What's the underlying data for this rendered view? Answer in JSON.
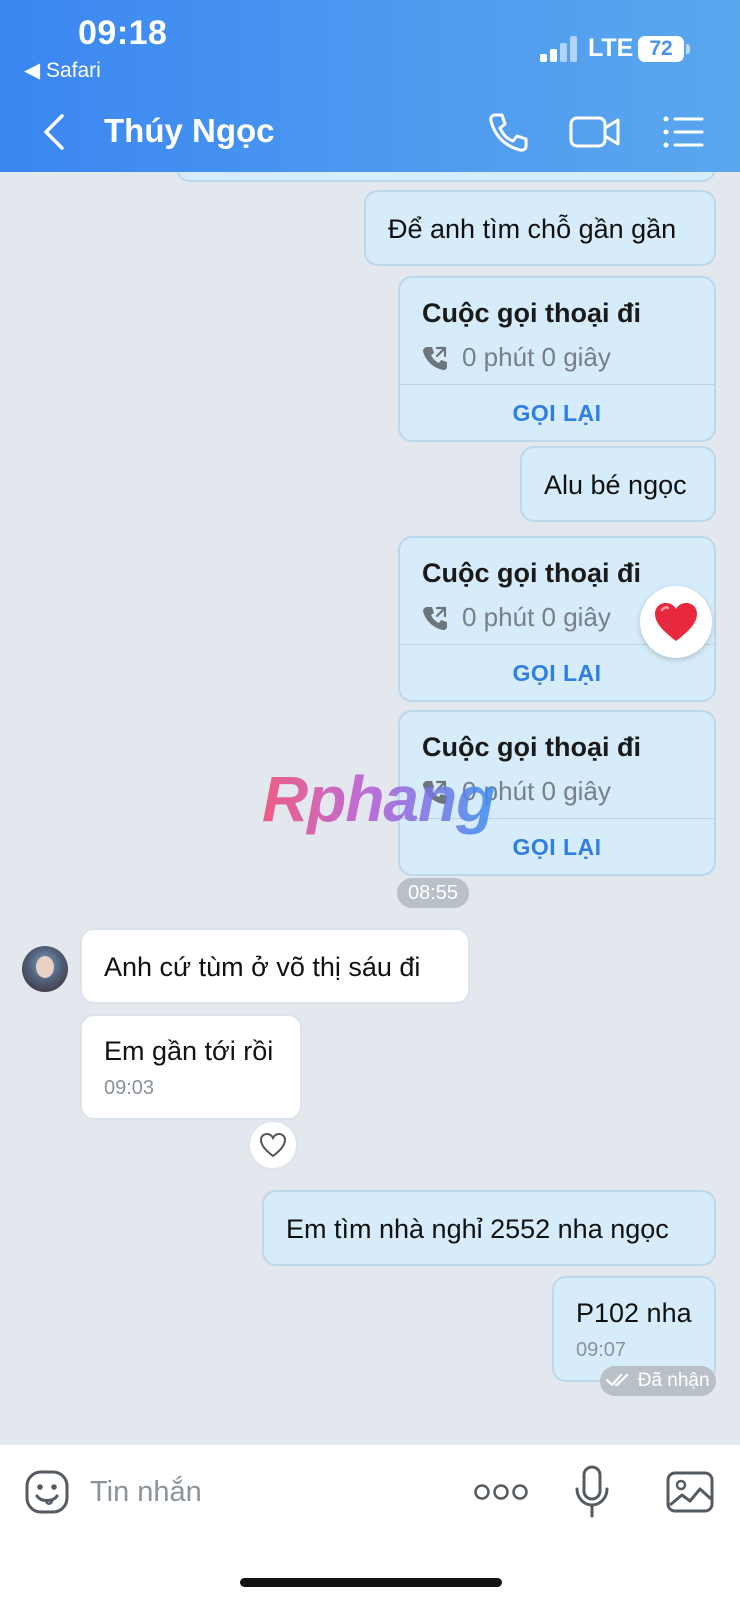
{
  "status_bar": {
    "time": "09:18",
    "back_app": "◀ Safari",
    "network": "LTE",
    "battery": "72"
  },
  "header": {
    "contact_name": "Thúy Ngọc",
    "icons": [
      "back-icon",
      "phone-icon",
      "video-call-icon",
      "menu-icon"
    ]
  },
  "messages": [
    {
      "direction": "out",
      "type": "text",
      "text": "Để anh tìm chỗ gần gần"
    },
    {
      "direction": "out",
      "type": "call",
      "title": "Cuộc gọi thoại đi",
      "duration": "0 phút 0 giây",
      "action": "GỌI LẠI"
    },
    {
      "direction": "out",
      "type": "text",
      "text": "Alu bé ngọc"
    },
    {
      "direction": "out",
      "type": "call",
      "title": "Cuộc gọi thoại đi",
      "duration": "0 phút 0 giây",
      "action": "GỌI LẠI",
      "reaction": "❤️"
    },
    {
      "direction": "out",
      "type": "call",
      "title": "Cuộc gọi thoại đi",
      "duration": "0 phút 0 giây",
      "action": "GỌI LẠI"
    },
    {
      "direction": "in",
      "type": "text",
      "text": "Anh cứ tùm ở võ thị sáu đi"
    },
    {
      "direction": "in",
      "type": "text",
      "text": "Em gần tới rồi",
      "time": "09:03"
    },
    {
      "direction": "out",
      "type": "text",
      "text": "Em tìm nhà nghỉ 2552 nha ngọc"
    },
    {
      "direction": "out",
      "type": "text",
      "text": "P102 nha",
      "time": "09:07"
    }
  ],
  "time_separator": "08:55",
  "read_receipt": "Đã nhận",
  "watermark": "Rphang",
  "composer": {
    "placeholder": "Tin nhắn",
    "icons": [
      "emoji-icon",
      "more-icon",
      "microphone-icon",
      "image-icon"
    ]
  },
  "colors": {
    "header_gradient_start": "#3a86f1",
    "header_gradient_end": "#5aa7ee",
    "outgoing_bubble": "#d6ecfa",
    "incoming_bubble": "#ffffff",
    "chat_background": "#e3e8ef",
    "action_link": "#2f7fe0"
  }
}
